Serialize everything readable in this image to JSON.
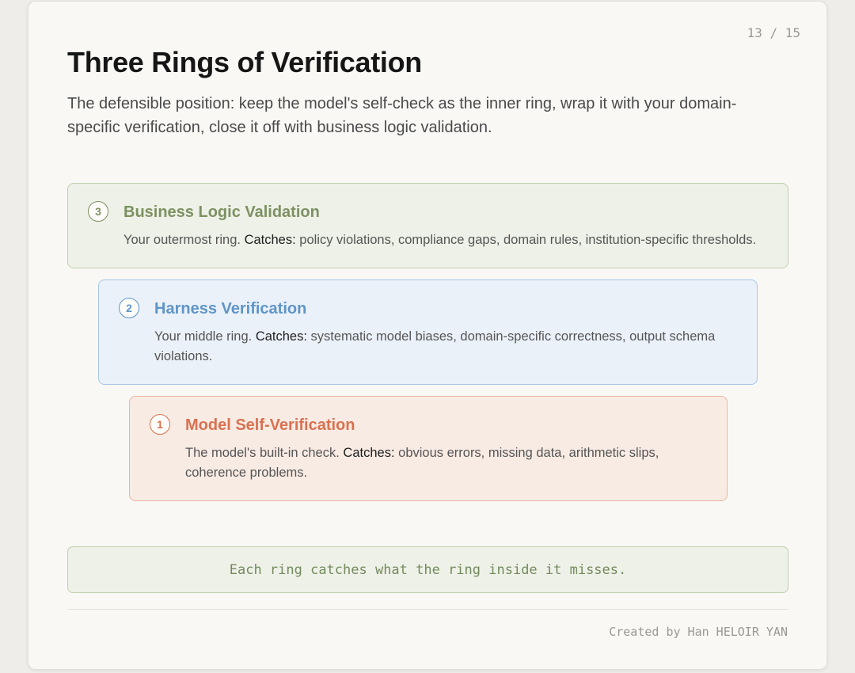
{
  "slide": {
    "page_number": "13 / 15",
    "title": "Three Rings of Verification",
    "subtitle": "The defensible position: keep the model's self-check as the inner ring, wrap it with your domain-specific verification, close it off with business logic validation."
  },
  "rings": [
    {
      "number": "3",
      "title": "Business Logic Validation",
      "intro": "Your outermost ring.",
      "keyword": "Catches:",
      "catches": "policy violations, compliance gaps, domain rules, institution-specific thresholds.",
      "color": "#7c9163"
    },
    {
      "number": "2",
      "title": "Harness Verification",
      "intro": "Your middle ring.",
      "keyword": "Catches:",
      "catches": "systematic model biases, domain-specific correctness, output schema violations.",
      "color": "#5f95c8"
    },
    {
      "number": "1",
      "title": "Model Self-Verification",
      "intro": "The model's built-in check.",
      "keyword": "Catches:",
      "catches": "obvious errors, missing data, arithmetic slips, coherence problems.",
      "color": "#da7150"
    }
  ],
  "footer": {
    "banner": "Each ring catches what the ring inside it misses.",
    "credit": "Created by Han HELOIR YAN"
  }
}
